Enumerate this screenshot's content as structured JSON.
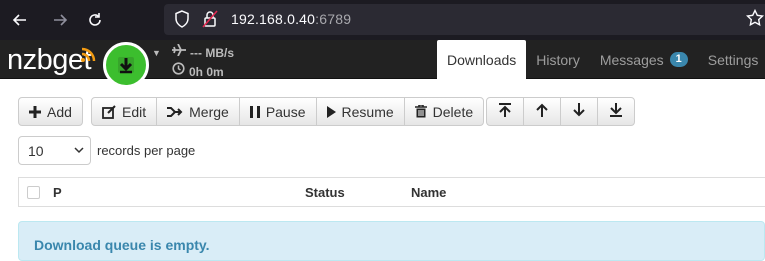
{
  "browser": {
    "url_host": "192.168.0.40",
    "url_port": ":6789"
  },
  "app": {
    "logo_text": "nzbget",
    "speed": "--- MB/s",
    "time_left": "0h 0m"
  },
  "tabs": [
    {
      "label": "Downloads",
      "active": true
    },
    {
      "label": "History"
    },
    {
      "label": "Messages",
      "badge": "1"
    },
    {
      "label": "Settings"
    }
  ],
  "toolbar": {
    "add": "Add",
    "edit": "Edit",
    "merge": "Merge",
    "pause": "Pause",
    "resume": "Resume",
    "delete": "Delete"
  },
  "pagination": {
    "records_value": "10",
    "records_label": "records per page"
  },
  "table": {
    "columns": [
      "P",
      "Status",
      "Name"
    ]
  },
  "empty_message": "Download queue is empty.",
  "colors": {
    "navbar": "#222222",
    "download_button": "#3cbe2e",
    "alert_bg": "#d9edf7",
    "alert_text": "#3a87ad",
    "badge": "#3a87ad"
  }
}
